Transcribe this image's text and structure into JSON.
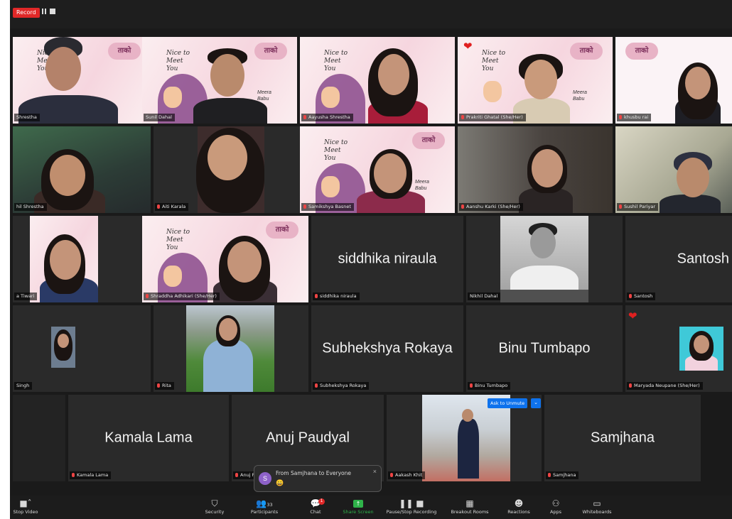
{
  "recording": {
    "label": "Record"
  },
  "tiles": [
    {
      "name": "Shrestha"
    },
    {
      "name": "Sunil Dahal"
    },
    {
      "name": "Aayusha Shrestha"
    },
    {
      "name": "Prakriti Ghatal (She/Her)"
    },
    {
      "name": "khusbu rai"
    },
    {
      "name": "hil Shrestha"
    },
    {
      "name": "Aiti Karala"
    },
    {
      "name": "Samikshya Basnet"
    },
    {
      "name": "Aanshu Karki (She/Her)"
    },
    {
      "name": "Sushil Pariyar"
    },
    {
      "name": "a Tiwari"
    },
    {
      "name": "Shraddha Adhikari (She/Her)"
    },
    {
      "name": "siddhika niraula",
      "big": "siddhika niraula"
    },
    {
      "name": "Nikhil Dahal"
    },
    {
      "name": "Santosh",
      "big": "Santosh"
    },
    {
      "name": "Singh"
    },
    {
      "name": "Rita"
    },
    {
      "name": "Subhekshya Rokaya",
      "big": "Subhekshya Rokaya"
    },
    {
      "name": "Binu Tumbapo",
      "big": "Binu Tumbapo"
    },
    {
      "name": "Maryada Neupane (She/Her)"
    },
    {
      "name": "Kamala Lama",
      "big": "Kamala Lama"
    },
    {
      "name": "Anuj Paudyal",
      "big": "Anuj Paudyal"
    },
    {
      "name": "Aakash Khit"
    },
    {
      "name": "Samjhana",
      "big": "Samjhana"
    }
  ],
  "slide": {
    "greeting": "Nice to Meet You",
    "logo": "ताको",
    "signoff": "Meera Babu"
  },
  "ask_unmute": {
    "label": "Ask to Unmute",
    "more": "⌄"
  },
  "chat_popup": {
    "from": "From Samjhana to Everyone",
    "message": "😀",
    "avatar": "S",
    "close": "×"
  },
  "toolbar": {
    "stop_video": "Stop Video",
    "security": "Security",
    "participants": "Participants",
    "participants_count": "33",
    "chat": "Chat",
    "chat_badge": "1",
    "share_screen": "Share Screen",
    "recording": "Pause/Stop Recording",
    "breakout": "Breakout Rooms",
    "reactions": "Reactions",
    "apps": "Apps",
    "whiteboards": "Whiteboards"
  },
  "colors": {
    "speaking_border": "#35c24a",
    "share_green": "#2fb34a",
    "mute_red": "#e44444",
    "unmute_blue": "#0e72ed"
  }
}
